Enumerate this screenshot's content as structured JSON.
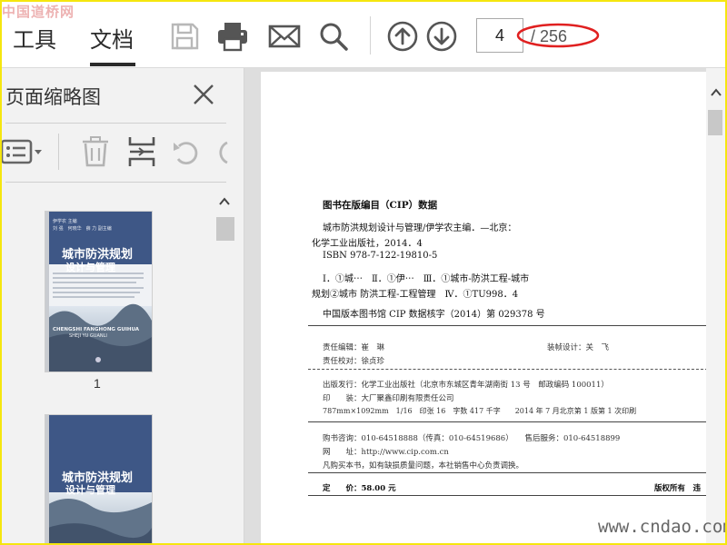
{
  "watermarks": {
    "top_left": "中国道桥网",
    "bottom_right": "www.cndao.com"
  },
  "toolbar": {
    "tabs": [
      {
        "label": "工具"
      },
      {
        "label": "文档"
      }
    ],
    "icons": [
      "save-icon",
      "print-icon",
      "mail-icon",
      "search-icon",
      "arrow-up-circle-icon",
      "arrow-down-circle-icon"
    ],
    "page_input_value": "4",
    "page_total": "/ 256",
    "highlight_color": "#e02020"
  },
  "panel": {
    "title": "页面缩略图",
    "icons": [
      "options-menu-icon",
      "trash-icon",
      "insert-page-icon",
      "undo-icon"
    ],
    "thumbnails": [
      {
        "page_number": "1",
        "title_line1": "城市防洪规划",
        "title_line2": "设计与管理"
      },
      {
        "page_number": "",
        "title_line1": "城市防洪规划",
        "title_line2": "设计与管理"
      }
    ]
  },
  "document": {
    "cip_heading": "图书在版编目（CIP）数据",
    "lines": [
      "城市防洪规划设计与管理/伊学农主编．—北京：",
      "化学工业出版社，2014．4",
      "ISBN 978-7-122-19810-5",
      "Ⅰ．①城⋯　Ⅱ．①伊⋯　Ⅲ．①城市-防洪工程-城市",
      "规划②城市 防洪工程-工程管理　Ⅳ．①TU998．4",
      "中国版本图书馆 CIP 数据核字（2014）第 029378 号"
    ],
    "editor": "责任编辑：崔　琳",
    "designer": "装帧设计：关　飞",
    "proofreader": "责任校对：徐贞珍",
    "publisher": "出版发行：化学工业出版社（北京市东城区青年湖南街 13 号　邮政编码 100011）",
    "printer": "印　　装：大厂聚鑫印刷有限责任公司",
    "spec": "787mm×1092mm　1/16　印张 16　字数 417 千字　　2014 年 7 月北京第 1 版第 1 次印刷",
    "consult": "购书咨询：010-64518888（传真：010-64519686）　　售后服务：010-64518899",
    "website": "网　　址：http://www.cip.com.cn",
    "notice": "凡购买本书，如有缺损质量问题，本社销售中心负责调换。",
    "price": "定　　价：58.00 元",
    "rights": "版权所有　违"
  }
}
